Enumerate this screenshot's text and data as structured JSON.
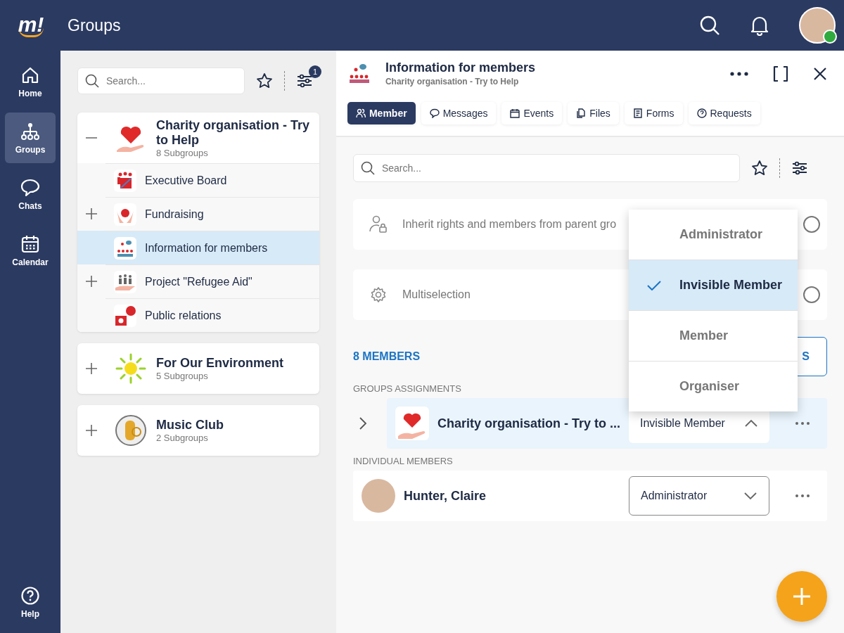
{
  "app": {
    "logo": "m!",
    "title": "Groups"
  },
  "nav": [
    {
      "label": "Home",
      "selected": false
    },
    {
      "label": "Groups",
      "selected": true
    },
    {
      "label": "Chats",
      "selected": false
    },
    {
      "label": "Calendar",
      "selected": false
    }
  ],
  "help": {
    "label": "Help"
  },
  "group_list": {
    "search": {
      "placeholder": "Search..."
    },
    "filter_badge": "1",
    "groups": [
      {
        "name": "Charity organisation - Try to Help",
        "subtitle": "8 Subgroups",
        "expanded": true,
        "children": [
          {
            "name": "Executive Board",
            "selected": false
          },
          {
            "name": "Fundraising",
            "selected": false,
            "expanded": false
          },
          {
            "name": "Information for members",
            "selected": true
          },
          {
            "name": "Project \"Refugee Aid\"",
            "selected": false,
            "expanded": false
          },
          {
            "name": "Public relations",
            "selected": false
          }
        ]
      },
      {
        "name": "For Our Environment",
        "subtitle": "5 Subgroups",
        "expanded": false
      },
      {
        "name": "Music Club",
        "subtitle": "2 Subgroups",
        "expanded": false
      }
    ]
  },
  "detail": {
    "title": "Information for members",
    "subtitle": "Charity organisation - Try to Help",
    "tabs": [
      {
        "label": "Member",
        "selected": true
      },
      {
        "label": "Messages",
        "selected": false
      },
      {
        "label": "Events",
        "selected": false
      },
      {
        "label": "Files",
        "selected": false
      },
      {
        "label": "Forms",
        "selected": false
      },
      {
        "label": "Requests",
        "selected": false
      }
    ],
    "search": {
      "placeholder": "Search..."
    },
    "settings": [
      {
        "label": "Inherit rights and members from parent gro",
        "on": false
      },
      {
        "label": "Multiselection",
        "on": false
      }
    ],
    "members_count": "8 MEMBERS",
    "members_button": "S",
    "group_assignments_label": "GROUPS ASSIGNMENTS",
    "group_assignments": [
      {
        "name": "Charity organisation - Try to ...",
        "role": "Invisible Member",
        "open": true
      }
    ],
    "individual_label": "INDIVIDUAL MEMBERS",
    "individuals": [
      {
        "name": "Hunter, Claire",
        "role": "Administrator",
        "open": false
      }
    ],
    "role_menu": [
      {
        "label": "Administrator",
        "selected": false
      },
      {
        "label": "Invisible Member",
        "selected": true
      },
      {
        "label": "Member",
        "selected": false
      },
      {
        "label": "Organiser",
        "selected": false
      }
    ]
  }
}
